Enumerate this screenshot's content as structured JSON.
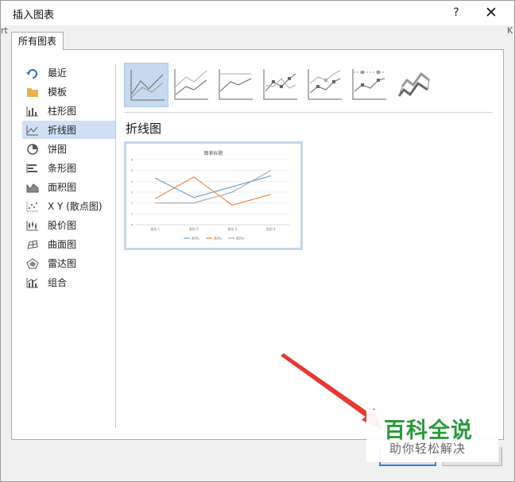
{
  "window": {
    "title": "插入图表",
    "help_label": "?",
    "close_label": "✕"
  },
  "background_fragments": {
    "left": "rt",
    "right": "K"
  },
  "tab": {
    "label": "所有图表"
  },
  "sidebar": {
    "items": [
      {
        "label": "最近",
        "icon": "recent-icon",
        "selected": false
      },
      {
        "label": "模板",
        "icon": "folder-icon",
        "selected": false
      },
      {
        "label": "柱形图",
        "icon": "column-chart-icon",
        "selected": false
      },
      {
        "label": "折线图",
        "icon": "line-chart-icon",
        "selected": true
      },
      {
        "label": "饼图",
        "icon": "pie-chart-icon",
        "selected": false
      },
      {
        "label": "条形图",
        "icon": "bar-chart-icon",
        "selected": false
      },
      {
        "label": "面积图",
        "icon": "area-chart-icon",
        "selected": false
      },
      {
        "label": "X Y (散点图)",
        "icon": "scatter-chart-icon",
        "selected": false
      },
      {
        "label": "股价图",
        "icon": "stock-chart-icon",
        "selected": false
      },
      {
        "label": "曲面图",
        "icon": "surface-chart-icon",
        "selected": false
      },
      {
        "label": "雷达图",
        "icon": "radar-chart-icon",
        "selected": false
      },
      {
        "label": "组合",
        "icon": "combo-chart-icon",
        "selected": false
      }
    ]
  },
  "gallery": {
    "selected_index": 0,
    "subtypes": [
      "line-icon",
      "stacked-line-icon",
      "100-stacked-line-icon",
      "line-markers-icon",
      "stacked-line-markers-icon",
      "100-stacked-line-markers-icon",
      "3d-line-icon"
    ]
  },
  "selected_type_title": "折线图",
  "chart_data": {
    "type": "line",
    "title": "图表标题",
    "categories": [
      "类别 1",
      "类别 2",
      "类别 3",
      "类别 4"
    ],
    "series": [
      {
        "name": "系列1",
        "values": [
          4.3,
          2.5,
          3.5,
          4.5
        ],
        "color": "#5b9bd5"
      },
      {
        "name": "系列2",
        "values": [
          2.4,
          4.4,
          1.8,
          2.8
        ],
        "color": "#ed7d31"
      },
      {
        "name": "系列3",
        "values": [
          2.0,
          2.0,
          3.0,
          5.0
        ],
        "color": "#a5a5a5"
      }
    ],
    "ylim": [
      0,
      6
    ],
    "yticks": [
      "0",
      "1",
      "2",
      "3",
      "4",
      "5",
      "6"
    ],
    "grid": true,
    "legend": "bottom"
  },
  "watermark": {
    "main": "百科全说",
    "sub": "助你轻松解决"
  },
  "colors": {
    "accent": "#3c7fd0",
    "selected_bg": "#cfe0f5",
    "watermark_green": "#2b9a3b",
    "arrow_red": "#e53935"
  }
}
